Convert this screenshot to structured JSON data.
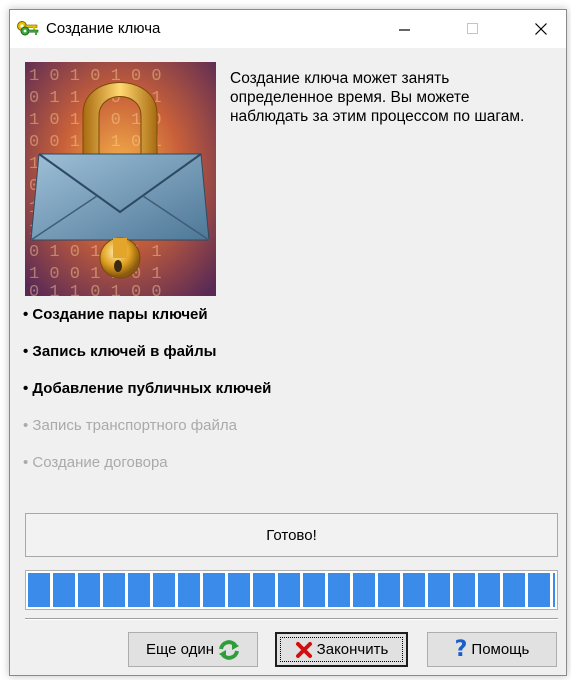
{
  "window": {
    "title": "Создание ключа"
  },
  "intro": {
    "text": "Создание ключа может занять определенное время. Вы можете наблюдать за этим процессом по шагам."
  },
  "steps": [
    {
      "label": "• Создание пары ключей",
      "state": "done"
    },
    {
      "label": "• Запись ключей в файлы",
      "state": "done"
    },
    {
      "label": "• Добавление публичных ключей",
      "state": "done"
    },
    {
      "label": "• Запись транспортного файла",
      "state": "pending"
    },
    {
      "label": "• Создание договора",
      "state": "pending"
    }
  ],
  "status": {
    "text": "Готово!"
  },
  "progress": {
    "value_percent": 100,
    "color": "#3b8bea"
  },
  "buttons": {
    "another_label": "Еще один",
    "finish_label": "Закончить",
    "help_label": "Помощь"
  },
  "icons": {
    "title": "keys-icon",
    "another": "refresh-icon",
    "finish": "red-x-icon",
    "help": "question-mark-icon"
  },
  "colors": {
    "title_bar": "#ffffff",
    "window_bg": "#f0f0f0",
    "pending_text": "#aaaaaa",
    "accent_green": "#2e9e3a",
    "finish_x_red": "#d01010",
    "help_blue": "#1a5fc8"
  }
}
